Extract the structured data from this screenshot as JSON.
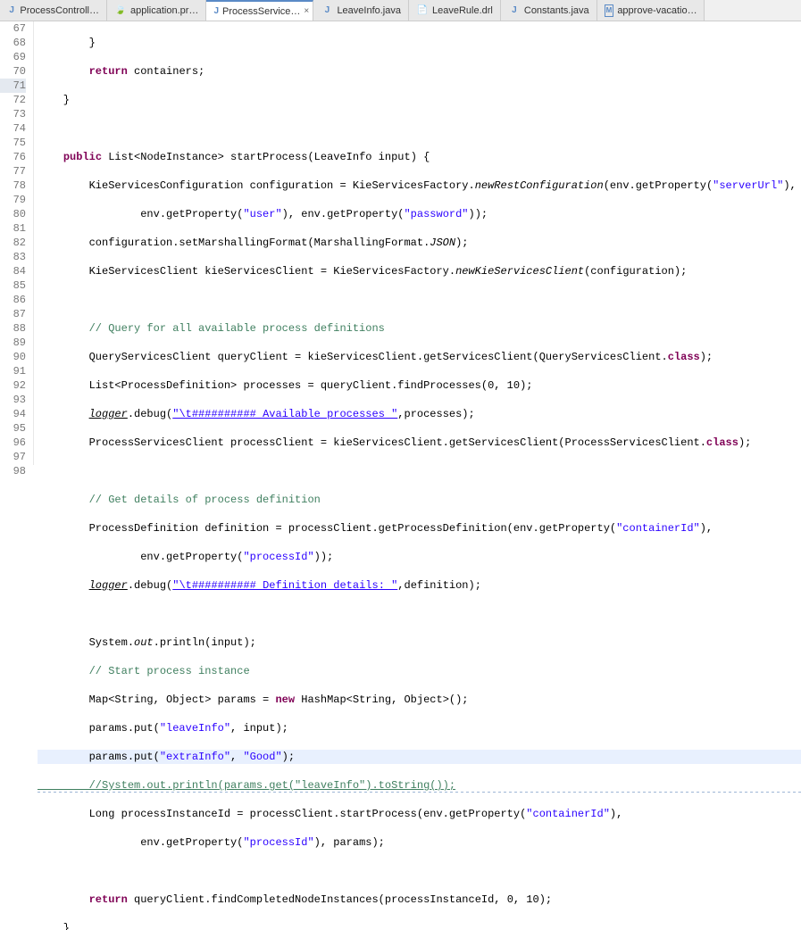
{
  "tabs": [
    {
      "icon": "J",
      "iconColor": "#5a8ac6",
      "label": "ProcessControll…",
      "active": false
    },
    {
      "icon": "🍃",
      "iconColor": "#7fbf3f",
      "label": "application.pr…",
      "active": false
    },
    {
      "icon": "J",
      "iconColor": "#5a8ac6",
      "label": "ProcessService…",
      "active": true,
      "close": "×"
    },
    {
      "icon": "J",
      "iconColor": "#5a8ac6",
      "label": "LeaveInfo.java",
      "active": false
    },
    {
      "icon": "📄",
      "iconColor": "#888",
      "label": "LeaveRule.drl",
      "active": false
    },
    {
      "icon": "J",
      "iconColor": "#5a8ac6",
      "label": "Constants.java",
      "active": false
    },
    {
      "icon": "M",
      "iconColor": "#5a8ac6",
      "label": "approve-vacatio…",
      "active": false
    }
  ],
  "lineStart": 67,
  "highlightedLine": 92,
  "highlightedGutter": 71,
  "code": {
    "l67": "        }",
    "l68_kw": "return",
    "l68_rest": " containers;",
    "l69": "    }",
    "l70": "",
    "l71_public": "public",
    "l71_rest1": " List<NodeInstance> startProcess(LeaveInfo input) {",
    "l72_a": "        KieServicesConfiguration configuration = KieServicesFactory.",
    "l72_m": "newRestConfiguration",
    "l72_b": "(env.getProperty(",
    "l72_s1": "\"serverUrl\"",
    "l72_c": "),",
    "l73_a": "                env.getProperty(",
    "l73_s1": "\"user\"",
    "l73_b": "), env.getProperty(",
    "l73_s2": "\"password\"",
    "l73_c": "));",
    "l74_a": "        configuration.setMarshallingFormat(MarshallingFormat.",
    "l74_f": "JSON",
    "l74_b": ");",
    "l75_a": "        KieServicesClient kieServicesClient = KieServicesFactory.",
    "l75_m": "newKieServicesClient",
    "l75_b": "(configuration);",
    "l76": "",
    "l77_c": "        // Query for all available process definitions",
    "l78_a": "        QueryServicesClient queryClient = kieServicesClient.getServicesClient(QueryServicesClient.",
    "l78_kw": "class",
    "l78_b": ");",
    "l79_a": "        List<ProcessDefinition> processes = queryClient.findProcesses(0, 10);",
    "l80_a": "        ",
    "l80_log": "logger",
    "l80_b": ".debug(",
    "l80_s": "\"\\t########## Available processes \"",
    "l80_c": ",processes);",
    "l81_a": "        ProcessServicesClient processClient = kieServicesClient.getServicesClient(ProcessServicesClient.",
    "l81_kw": "class",
    "l81_b": ");",
    "l82": "",
    "l83_c": "        // Get details of process definition",
    "l84_a": "        ProcessDefinition definition = processClient.getProcessDefinition(env.getProperty(",
    "l84_s": "\"containerId\"",
    "l84_b": "),",
    "l85_a": "                env.getProperty(",
    "l85_s": "\"processId\"",
    "l85_b": "));",
    "l86_a": "        ",
    "l86_log": "logger",
    "l86_b": ".debug(",
    "l86_s": "\"\\t########## Definition details: \"",
    "l86_c": ",definition);",
    "l87": "",
    "l88_a": "        System.",
    "l88_out": "out",
    "l88_b": ".println(input);",
    "l89_c": "        // Start process instance",
    "l90_a": "        Map<String, Object> params = ",
    "l90_kw": "new",
    "l90_b": " HashMap<String, Object>();",
    "l91_a": "        params.put(",
    "l91_s": "\"leaveInfo\"",
    "l91_b": ", input);",
    "l92_a": "        params.put(",
    "l92_s1": "\"extraInfo\"",
    "l92_b": ", ",
    "l92_s2": "\"Good\"",
    "l92_c": ");",
    "l93_c": "        //System.out.println(params.get(\"leaveInfo\").toString());",
    "l94_a": "        Long processInstanceId = processClient.startProcess(env.getProperty(",
    "l94_s": "\"containerId\"",
    "l94_b": "),",
    "l95_a": "                env.getProperty(",
    "l95_s": "\"processId\"",
    "l95_b": "), params);",
    "l96": "",
    "l97_a": "        ",
    "l97_kw": "return",
    "l97_b": " queryClient.findCompletedNodeInstances(processInstanceId, 0, 10);",
    "l98": "    }"
  }
}
